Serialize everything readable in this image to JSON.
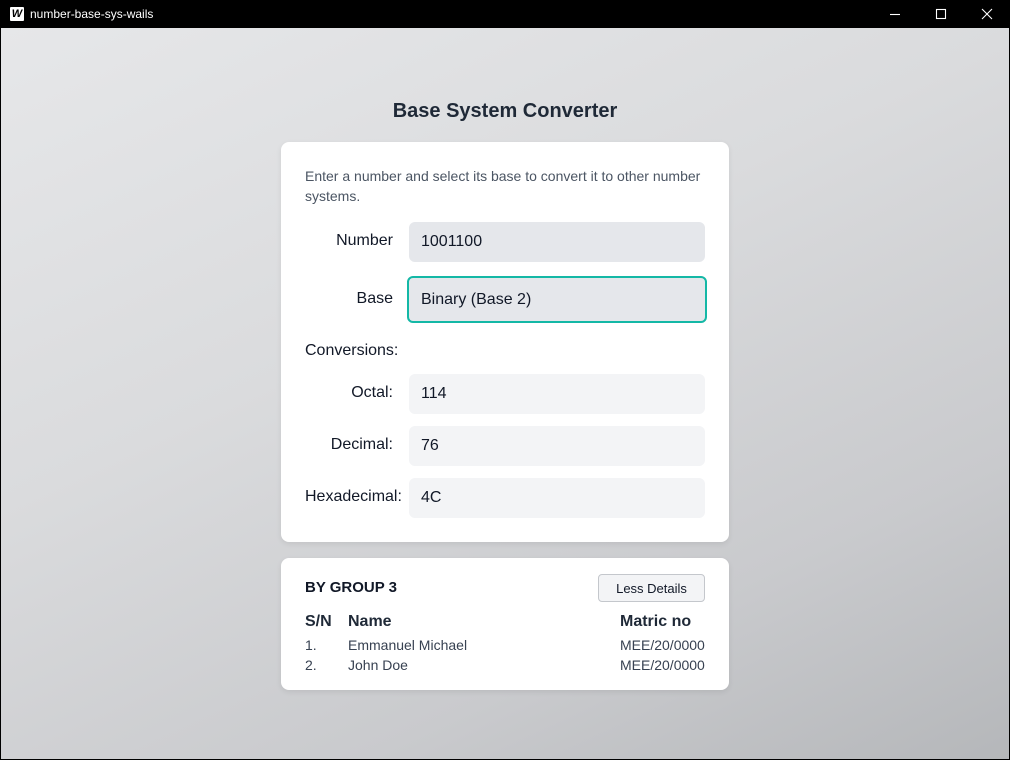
{
  "window": {
    "title": "number-base-sys-wails",
    "logo_glyph": "W",
    "controls": [
      "minimize-icon",
      "maximize-icon",
      "close-icon"
    ]
  },
  "page": {
    "title": "Base System Converter"
  },
  "converter": {
    "intro": "Enter a number and select its base to convert it to other number systems.",
    "number_label": "Number",
    "number_value": "1001100",
    "base_label": "Base",
    "base_value": "Binary (Base 2)",
    "conversions_label": "Conversions:",
    "octal_label": "Octal:",
    "octal_value": "114",
    "decimal_label": "Decimal:",
    "decimal_value": "76",
    "hex_label": "Hexadecimal:",
    "hex_value": "4C"
  },
  "group": {
    "title": "BY GROUP 3",
    "toggle_label": "Less Details",
    "headers": {
      "sn": "S/N",
      "name": "Name",
      "matric": "Matric no"
    },
    "members": [
      {
        "sn": "1.",
        "name": "Emmanuel Michael",
        "matric": "MEE/20/0000"
      },
      {
        "sn": "2.",
        "name": "John Doe",
        "matric": "MEE/20/0000"
      }
    ]
  },
  "colors": {
    "accent": "#14b8a6",
    "titlebar": "#000000",
    "heading": "#1f2937"
  }
}
